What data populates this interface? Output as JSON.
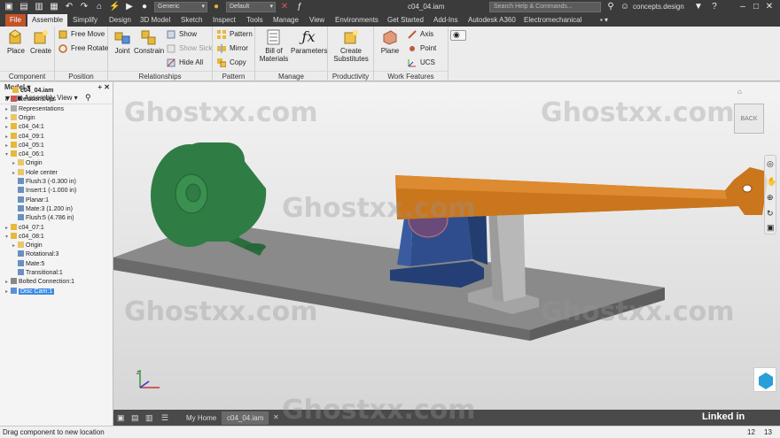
{
  "titlebar": {
    "material_value": "Generic",
    "appearance_value": "Default",
    "document_title": "c04_04.iam",
    "search_placeholder": "Search Help & Commands...",
    "user_name": "concepts.design"
  },
  "tabs": [
    "File",
    "Assemble",
    "Simplify",
    "Design",
    "3D Model",
    "Sketch",
    "Inspect",
    "Tools",
    "Manage",
    "View",
    "Environments",
    "Get Started",
    "Add-Ins",
    "Autodesk A360",
    "Electromechanical"
  ],
  "ribbon": {
    "component": {
      "label": "Component",
      "place": "Place",
      "create": "Create"
    },
    "position": {
      "label": "Position",
      "free_move": "Free Move",
      "free_rotate": "Free Rotate"
    },
    "relationships": {
      "label": "Relationships",
      "joint": "Joint",
      "constrain": "Constrain",
      "show": "Show",
      "show_sick": "Show Sick",
      "hide_all": "Hide All"
    },
    "pattern": {
      "label": "Pattern",
      "pattern": "Pattern",
      "mirror": "Mirror",
      "copy": "Copy"
    },
    "manage": {
      "label": "Manage",
      "bom_line1": "Bill of",
      "bom_line2": "Materials",
      "parameters": "Parameters"
    },
    "productivity": {
      "label": "Productivity",
      "line1": "Create",
      "line2": "Substitutes"
    },
    "work_features": {
      "label": "Work Features",
      "plane": "Plane",
      "axis": "Axis",
      "point": "Point",
      "ucs": "UCS"
    }
  },
  "browser": {
    "title": "Model",
    "view_mode": "Assembly View",
    "root": "c04_04.iam",
    "items": [
      "Relationships",
      "Representations",
      "Origin",
      "c04_04:1",
      "c04_09:1",
      "c04_05:1",
      "c04_06:1",
      "Origin",
      "Hole center",
      "Flush:3 (-0.300 in)",
      "Insert:1 (-1.000 in)",
      "Planar:1",
      "Mate:3 (1.200 in)",
      "Flush:5 (4.786 in)",
      "c04_07:1",
      "c04_08:1",
      "Origin",
      "Rotational:3",
      "Mate:5",
      "Transitional:1",
      "Bolted Connection:1",
      "Disc Cam:1"
    ]
  },
  "viewcube_label": "BACK",
  "doc_tabs": {
    "home": "My Home",
    "doc": "c04_04.iam"
  },
  "status": {
    "message": "Drag component to new location",
    "count_a": "12",
    "count_b": "13"
  },
  "watermark": "Ghostxx.com",
  "brand": "Linked in",
  "colors": {
    "file_tab": "#c0552a",
    "motor": "#2f7d45",
    "arm": "#c9761d",
    "bracket": "#2f4d8c",
    "plate": "#8a8a8a",
    "support": "#b4b4b4"
  }
}
